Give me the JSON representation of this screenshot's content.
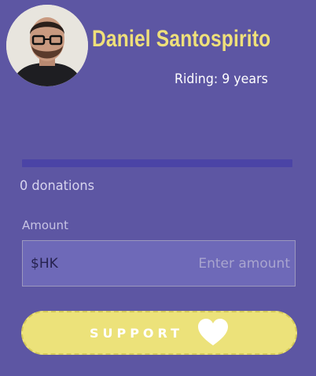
{
  "profile": {
    "name": "Daniel Santospirito",
    "riding": "Riding: 9 years",
    "avatar_icon": "person-photo"
  },
  "progress": {
    "fraction": 0.0
  },
  "donations": {
    "text": "0 donations"
  },
  "amount": {
    "label": "Amount",
    "currency": "$HK",
    "placeholder": "Enter amount",
    "value": ""
  },
  "support": {
    "label": "SUPPORT",
    "icon": "heart-icon"
  },
  "colors": {
    "background": "#5d56a3",
    "name": "#efe07a",
    "button": "#ece27a",
    "input_bg": "#6e69b8"
  }
}
